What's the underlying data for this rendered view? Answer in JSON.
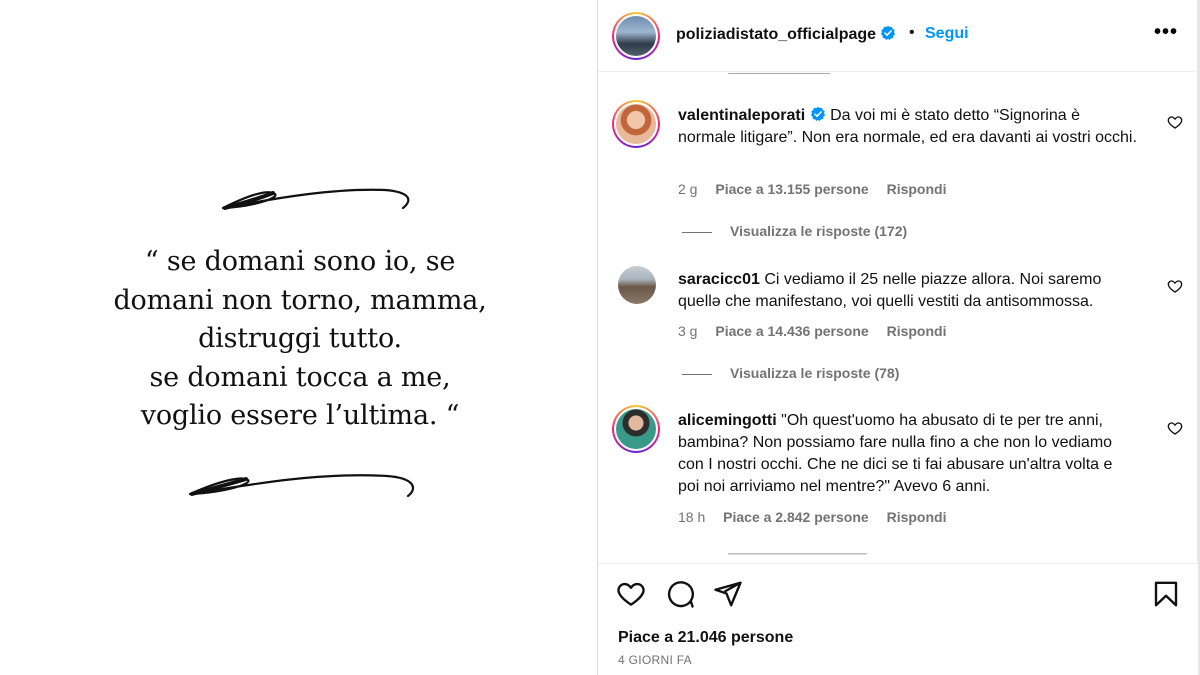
{
  "post": {
    "quote_lines": [
      "“ se domani sono io, se",
      "domani non torno, mamma,",
      "distruggi tutto.",
      "se domani tocca a me,",
      "voglio essere l’ultima. “"
    ]
  },
  "header": {
    "username": "poliziadistato_officialpage",
    "separator": "•",
    "follow_label": "Segui",
    "more_label": "•••",
    "more_icon": "more-horizontal-icon",
    "verified_icon": "verified-badge-icon"
  },
  "comments": [
    {
      "username": "valentinaleporati",
      "verified": true,
      "text": "Da voi mi è stato detto “Signorina è normale litigare”. Non era normale, ed era davanti ai vostri occhi.",
      "time": "2 g",
      "likes": "Piace a 13.155 persone",
      "reply": "Rispondi",
      "view_replies": "Visualizza le risposte (172)"
    },
    {
      "username": "saracicc01",
      "verified": false,
      "text": "Ci vediamo il 25 nelle piazze allora. Noi saremo quellə che manifestano, voi quelli vestiti da antisommossa.",
      "time": "3 g",
      "likes": "Piace a 14.436 persone",
      "reply": "Rispondi",
      "view_replies": "Visualizza le risposte (78)"
    },
    {
      "username": "alicemingotti",
      "verified": false,
      "text": "\"Oh quest'uomo ha abusato di te per tre anni, bambina? Non possiamo fare nulla fino a che non lo vediamo con I nostri occhi. Che ne dici se ti fai abusare un'altra volta e poi noi arriviamo nel mentre?\" Avevo 6 anni.",
      "time": "18 h",
      "likes": "Piace a 2.842 persone",
      "reply": "Rispondi"
    }
  ],
  "actions": {
    "like_icon": "heart-icon",
    "comment_icon": "comment-icon",
    "share_icon": "send-icon",
    "save_icon": "bookmark-icon",
    "likes_total": "Piace a 21.046 persone",
    "time_ago": "4 GIORNI FA"
  },
  "colors": {
    "accent": "#0095f6",
    "secondary_text": "#737373",
    "verified": "#0095f6"
  }
}
